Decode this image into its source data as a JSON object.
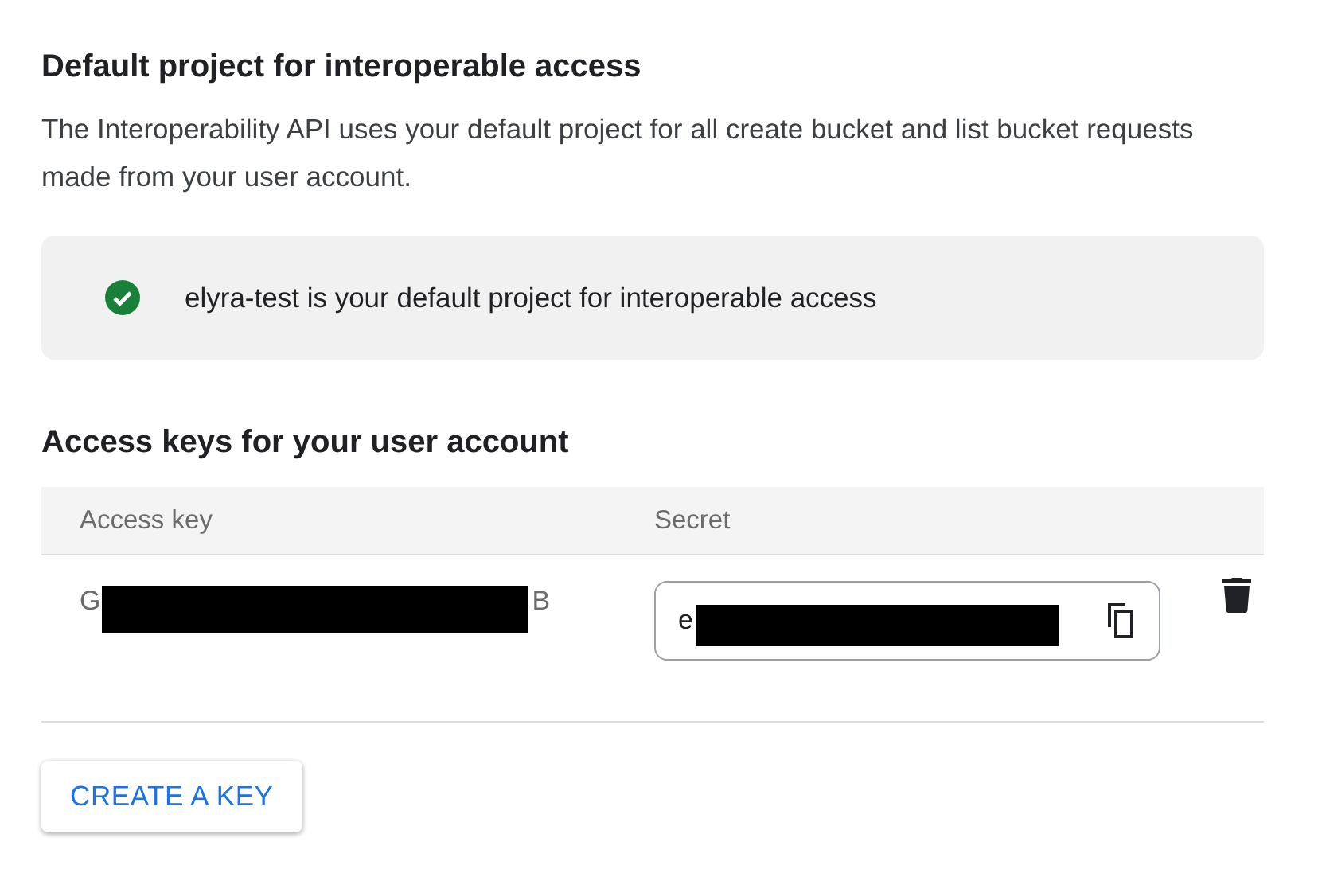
{
  "section": {
    "title": "Default project for interoperable access",
    "description": "The Interoperability API uses your default project for all create bucket and list bucket requests made from your user account."
  },
  "notice": {
    "text": "elyra-test is your default project for interoperable access"
  },
  "keys": {
    "title": "Access keys for your user account",
    "columns": [
      "Access key",
      "Secret"
    ],
    "rows": [
      {
        "access_key_start": "G",
        "access_key_end": "B",
        "secret_start": "e",
        "redacted": true
      }
    ]
  },
  "buttons": [
    "CREATE A KEY"
  ]
}
